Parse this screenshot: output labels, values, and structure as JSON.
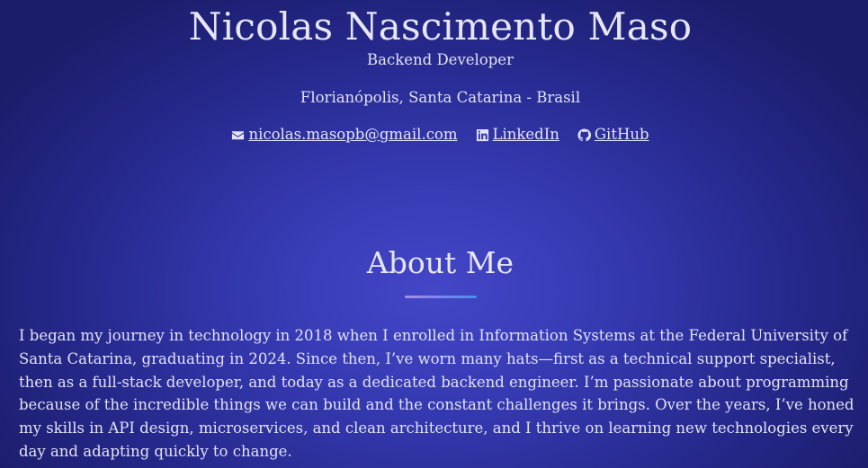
{
  "profile": {
    "name": "Nicolas Nascimento Maso",
    "role": "Backend Developer",
    "location": "Florianópolis, Santa Catarina - Brasil"
  },
  "links": {
    "email": {
      "label": "nicolas.masopb@gmail.com",
      "icon": "envelope-icon"
    },
    "linkedin": {
      "label": "LinkedIn",
      "icon": "linkedin-icon"
    },
    "github": {
      "label": "GitHub",
      "icon": "github-icon"
    }
  },
  "about": {
    "title": "About Me",
    "text": "I began my journey in technology in 2018 when I enrolled in Information Systems at the Federal University of Santa Catarina, graduating in 2024. Since then, I’ve worn many hats—first as a technical support specialist, then as a full-stack developer, and today as a dedicated backend engineer. I’m passionate about programming because of the incredible things we can build and the constant challenges it brings. Over the years, I’ve honed my skills in API design, microservices, and clean architecture, and I thrive on learning new technologies every day and adapting quickly to change."
  },
  "colors": {
    "background_center": "#4347c8",
    "background_edge": "#1b1d6a",
    "text": "#e2e2f4",
    "accent_gradient_start": "#a88ee6",
    "accent_gradient_end": "#4a8de8"
  }
}
